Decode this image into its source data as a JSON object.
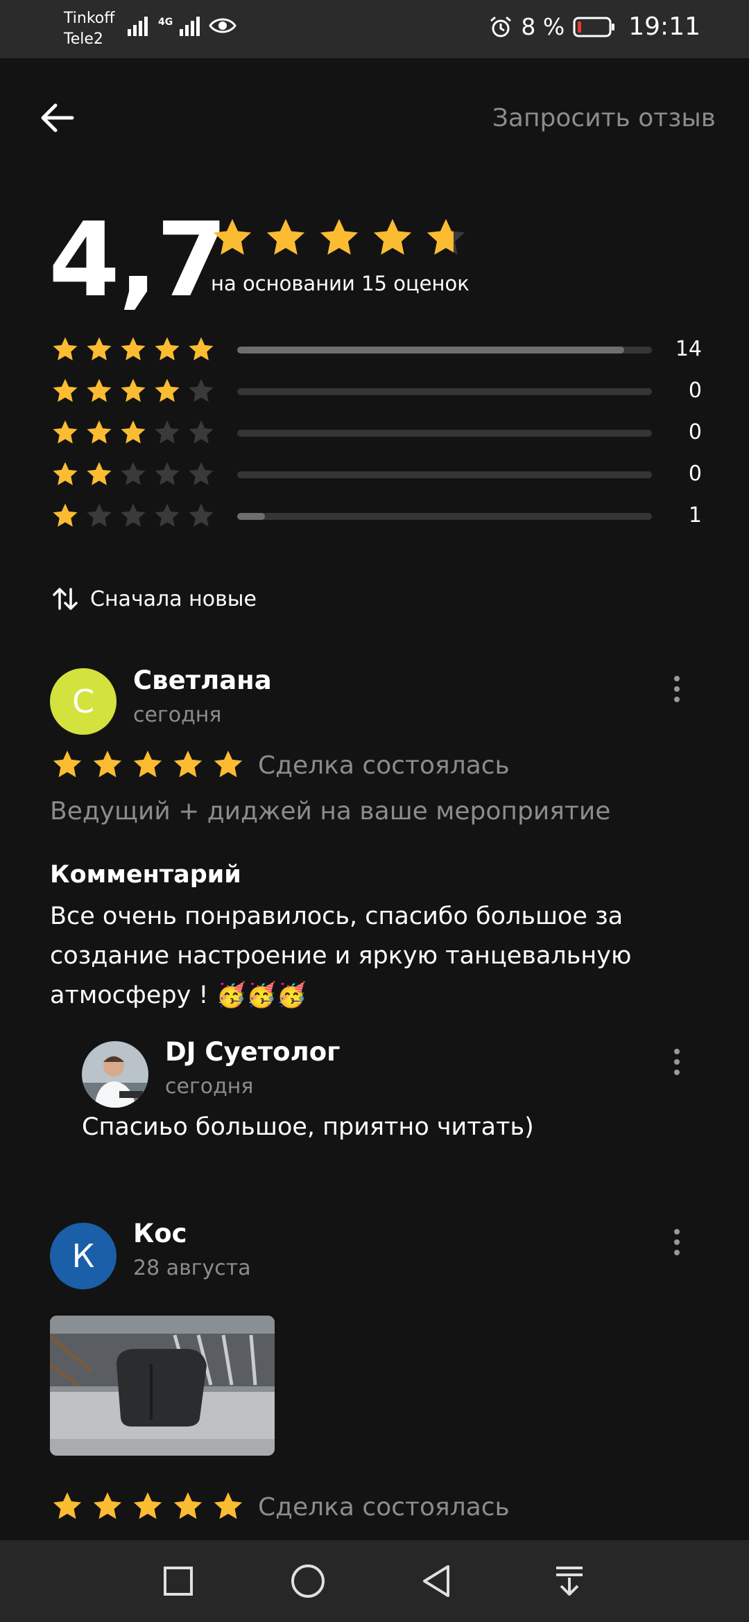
{
  "status_bar": {
    "carrier_1": "Tinkoff",
    "carrier_2": "Tele2",
    "network_label": "4G",
    "battery_percent": "8 %",
    "time": "19:11"
  },
  "header": {
    "back_icon": "arrow-left-icon",
    "request_review_label": "Запросить отзыв"
  },
  "summary": {
    "rating": "4,7",
    "rating_value": 4.7,
    "caption": "на основании 15 оценок",
    "distribution": [
      {
        "stars": 5,
        "count": "14",
        "fraction": 0.9333
      },
      {
        "stars": 4,
        "count": "0",
        "fraction": 0
      },
      {
        "stars": 3,
        "count": "0",
        "fraction": 0
      },
      {
        "stars": 2,
        "count": "0",
        "fraction": 0
      },
      {
        "stars": 1,
        "count": "1",
        "fraction": 0.0667
      }
    ]
  },
  "sort": {
    "icon": "sort-arrows-icon",
    "label": "Сначала новые"
  },
  "reviews": [
    {
      "avatar_letter": "С",
      "avatar_color": "#d3e23d",
      "author": "Светлана",
      "date": "сегодня",
      "rating": 5,
      "deal_status": "Сделка состоялась",
      "service": "Ведущий + диджей на ваше мероприятие",
      "comment_title": "Комментарий",
      "comment_text": "Все очень понравилось, спасибо большое за создание настроение и яркую танцевальную атмосферу ! 🥳🥳🥳",
      "reply": {
        "author": "DJ Суетолог",
        "date": "сегодня",
        "text": "Спасиьо большое, приятно читать)"
      }
    },
    {
      "avatar_letter": "К",
      "avatar_color": "#1a5fa8",
      "author": "Кос",
      "date": "28 августа",
      "rating": 5,
      "deal_status": "Сделка состоялась"
    }
  ],
  "colors": {
    "background": "#131313",
    "star_filled": "#fbbc32",
    "star_empty": "#3a3a3a",
    "muted_text": "#8c8c8c"
  },
  "nav_icons": [
    "square-icon",
    "circle-icon",
    "triangle-back-icon",
    "notification-down-icon"
  ]
}
